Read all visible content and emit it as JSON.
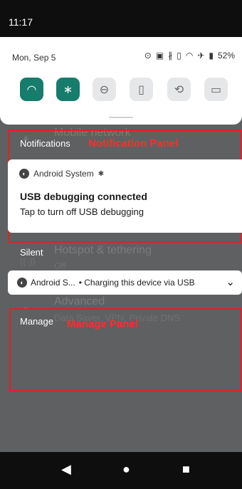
{
  "status_bar": {
    "time": "11:17"
  },
  "background_settings": {
    "items": [
      {
        "title": "Mobile network",
        "subtitle": ""
      },
      {
        "title": "Hotspot & tethering",
        "subtitle": "Off"
      },
      {
        "title": "Advanced",
        "subtitle": "Data Saver, VPN, Private DNS"
      }
    ]
  },
  "quick_settings": {
    "date": "Mon, Sep 5",
    "battery": "52%",
    "tiles": [
      {
        "name": "wifi",
        "icon": "wifi-icon",
        "active": true
      },
      {
        "name": "bluetooth",
        "icon": "bluetooth-icon",
        "active": true
      },
      {
        "name": "do-not-disturb",
        "icon": "dnd-icon",
        "active": false
      },
      {
        "name": "flashlight",
        "icon": "flashlight-icon",
        "active": false
      },
      {
        "name": "auto-rotate",
        "icon": "rotate-icon",
        "active": false
      },
      {
        "name": "battery-saver",
        "icon": "battery-saver-icon",
        "active": false
      }
    ],
    "accent_color": "#167c6c"
  },
  "notifications": {
    "header": "Notifications",
    "annotation_label": "Notification Panel",
    "card": {
      "app": "Android System",
      "title": "USB debugging connected",
      "text": "Tap to turn off USB debugging"
    }
  },
  "silent": {
    "header": "Silent",
    "card": {
      "app": "Android S...",
      "text": "• Charging this device via USB"
    }
  },
  "manage": {
    "header": "Manage",
    "annotation_label": "Manage Panel"
  },
  "annotation_color": "#e0202a"
}
